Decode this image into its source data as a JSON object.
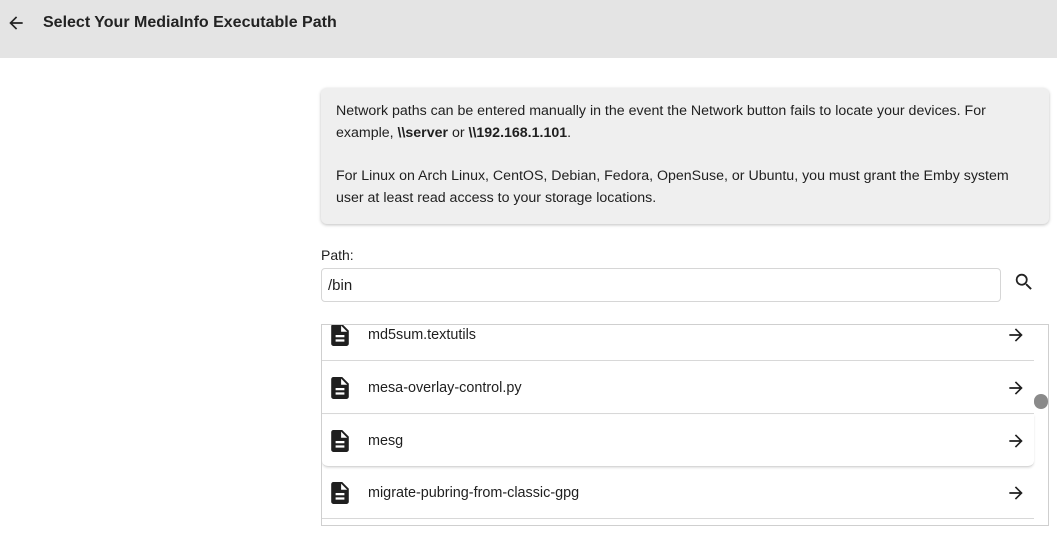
{
  "header": {
    "title": "Select Your MediaInfo Executable Path",
    "back_icon": "arrow-left-icon"
  },
  "info": {
    "p1_part1": "Network paths can be entered manually in the event the Network button fails to locate your devices. For example, ",
    "p1_bold1": "\\\\server",
    "p1_or": " or ",
    "p1_bold2": "\\\\192.168.1.101",
    "p1_end": ".",
    "p2": "For Linux on Arch Linux, CentOS, Debian, Fedora, OpenSuse, or Ubuntu, you must grant the Emby system user at least read access to your storage locations."
  },
  "path": {
    "label": "Path:",
    "value": "/bin",
    "search_icon": "search-icon"
  },
  "files": [
    {
      "name": "md5sum.textutils",
      "icon": "file-icon",
      "action_icon": "arrow-right-icon"
    },
    {
      "name": "mesa-overlay-control.py",
      "icon": "file-icon",
      "action_icon": "arrow-right-icon"
    },
    {
      "name": "mesg",
      "icon": "file-icon",
      "action_icon": "arrow-right-icon"
    },
    {
      "name": "migrate-pubring-from-classic-gpg",
      "icon": "file-icon",
      "action_icon": "arrow-right-icon"
    }
  ]
}
